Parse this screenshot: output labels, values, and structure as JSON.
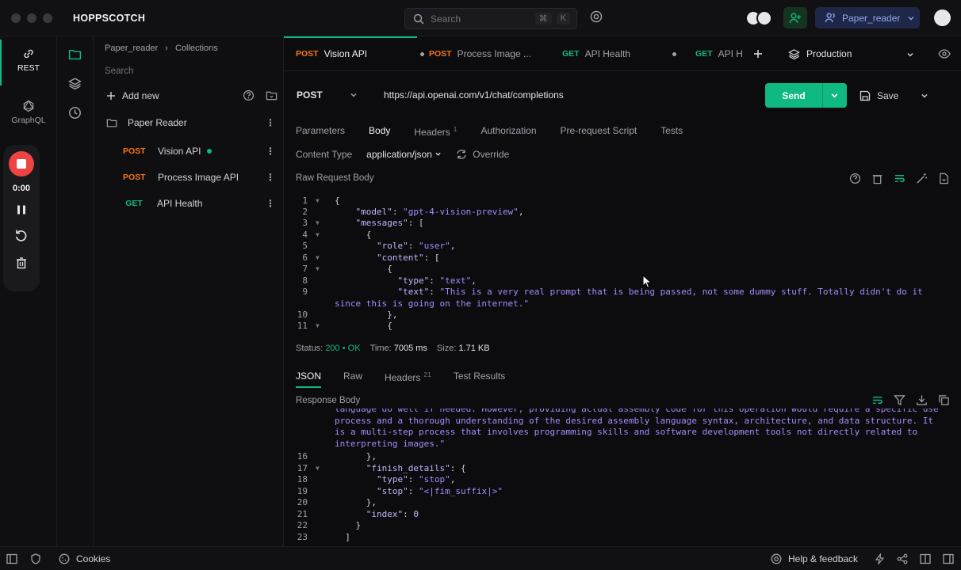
{
  "app": {
    "title": "HOPPSCOTCH"
  },
  "search": {
    "placeholder": "Search",
    "key1": "⌘",
    "key2": "K"
  },
  "workspace": {
    "name": "Paper_reader"
  },
  "rail": {
    "rest_label": "REST",
    "graphql_label": "GraphQL"
  },
  "recorder": {
    "time": "0:00"
  },
  "tree": {
    "breadcrumb_root": "Paper_reader",
    "breadcrumb_leaf": "Collections",
    "search_placeholder": "Search",
    "add_new": "Add new",
    "collection_name": "Paper Reader",
    "requests": [
      {
        "method": "POST",
        "name": "Vision API"
      },
      {
        "method": "POST",
        "name": "Process Image API"
      },
      {
        "method": "GET",
        "name": "API Health"
      }
    ]
  },
  "tabs": [
    {
      "method": "POST",
      "name": "Vision API"
    },
    {
      "method": "POST",
      "name": "Process Image ..."
    },
    {
      "method": "GET",
      "name": "API Health"
    },
    {
      "method": "GET",
      "name": "API H"
    }
  ],
  "environment": {
    "name": "Production"
  },
  "request": {
    "method": "POST",
    "url": "https://api.openai.com/v1/chat/completions",
    "send_label": "Send",
    "save_label": "Save",
    "tabs": [
      "Parameters",
      "Body",
      "Headers",
      "Authorization",
      "Pre-request Script",
      "Tests"
    ],
    "headers_count": "1",
    "content_type_label": "Content Type",
    "content_type": "application/json",
    "override_label": "Override",
    "body_label": "Raw Request Body"
  },
  "response": {
    "status_label": "Status:",
    "status_code": "200",
    "status_text": "OK",
    "time_label": "Time:",
    "time_value": "7005 ms",
    "size_label": "Size:",
    "size_value": "1.71 KB",
    "tabs": [
      "JSON",
      "Raw",
      "Headers",
      "Test Results"
    ],
    "headers_count": "21",
    "body_label": "Response Body"
  },
  "footer": {
    "cookies": "Cookies",
    "help": "Help & feedback"
  }
}
